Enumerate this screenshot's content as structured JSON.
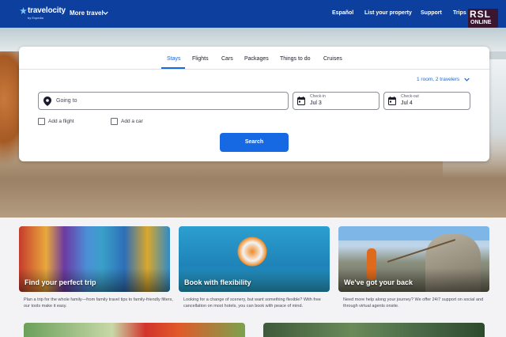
{
  "header": {
    "logo_text": "travelocity",
    "logo_sub": "by Expedia",
    "more_travel": "More travel",
    "links": [
      "Español",
      "List your property",
      "Support",
      "Trips"
    ],
    "badge_top": "RSL",
    "badge_bottom": "ONLINE"
  },
  "search": {
    "tabs": [
      "Stays",
      "Flights",
      "Cars",
      "Packages",
      "Things to do",
      "Cruises"
    ],
    "active_tab": "Stays",
    "travelers": "1 room, 2 travelers",
    "going_to_placeholder": "Going to",
    "check_in_label": "Check-in",
    "check_in_value": "Jul 3",
    "check_out_label": "Check-out",
    "check_out_value": "Jul 4",
    "add_flight": "Add a flight",
    "add_car": "Add a car",
    "search_button": "Search",
    "accent_color": "#1668e3"
  },
  "promos": [
    {
      "title": "Find your perfect trip",
      "description": "Plan a trip for the whole family—from family travel tips to family-friendly filters, our tools make it easy."
    },
    {
      "title": "Book with flexibility",
      "description": "Looking for a change of scenery, but want something flexible? With free cancellation on most hotels, you can book with peace of mind."
    },
    {
      "title": "We've got your back",
      "description": "Need more help along your journey? We offer 24/7 support on social and through virtual agents onsite."
    }
  ]
}
